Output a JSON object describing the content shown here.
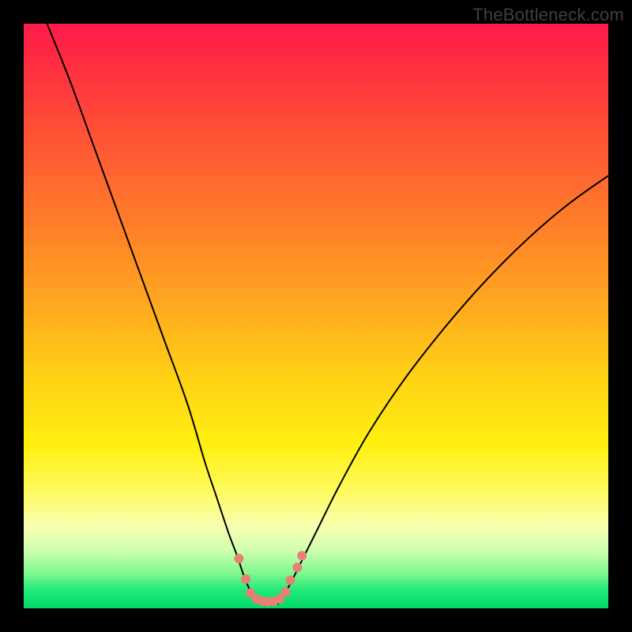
{
  "watermark": "TheBottleneck.com",
  "chart_data": {
    "type": "line",
    "title": "",
    "xlabel": "",
    "ylabel": "",
    "xlim": [
      0,
      100
    ],
    "ylim": [
      0,
      100
    ],
    "series": [
      {
        "name": "left-curve",
        "x": [
          4,
          8,
          12,
          16,
          20,
          24,
          28,
          31,
          33,
          35,
          36.5,
          37.5,
          38.5,
          39.5
        ],
        "y": [
          100,
          90,
          79,
          68,
          57,
          46,
          35,
          25,
          19,
          13,
          9,
          6,
          3.5,
          1.5
        ]
      },
      {
        "name": "right-curve",
        "x": [
          44,
          45.5,
          47.5,
          50,
          54,
          59,
          65,
          72,
          79,
          86,
          93,
          100
        ],
        "y": [
          1.5,
          4,
          8,
          13,
          21,
          30,
          39,
          48,
          56,
          63,
          69,
          74
        ]
      },
      {
        "name": "floor",
        "x": [
          39.5,
          40.5,
          41.5,
          42.5,
          43.5,
          44
        ],
        "y": [
          1.5,
          0.8,
          0.6,
          0.6,
          0.8,
          1.5
        ]
      }
    ],
    "markers": [
      {
        "x": 36.8,
        "y": 8.5
      },
      {
        "x": 38.0,
        "y": 5.0
      },
      {
        "x": 38.8,
        "y": 2.6
      },
      {
        "x": 39.8,
        "y": 1.6
      },
      {
        "x": 40.8,
        "y": 1.2
      },
      {
        "x": 41.8,
        "y": 1.1
      },
      {
        "x": 42.8,
        "y": 1.2
      },
      {
        "x": 43.8,
        "y": 1.6
      },
      {
        "x": 44.8,
        "y": 2.8
      },
      {
        "x": 45.6,
        "y": 4.8
      },
      {
        "x": 46.8,
        "y": 7.0
      },
      {
        "x": 47.6,
        "y": 9.0
      }
    ],
    "marker_radius": 6
  }
}
